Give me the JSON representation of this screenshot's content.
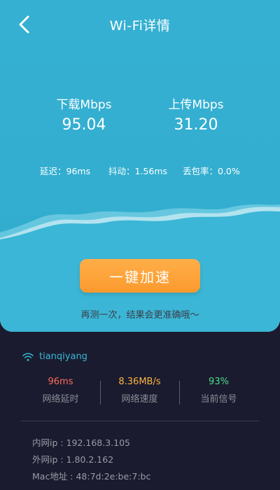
{
  "header": {
    "title": "Wi-Fi详情",
    "back_icon": "chevron-left-icon"
  },
  "speed": {
    "download_label": "下载Mbps",
    "download_value": "95.04",
    "upload_label": "上传Mbps",
    "upload_value": "31.20"
  },
  "stats": {
    "latency": "延迟：96ms",
    "jitter": "抖动：1.56ms",
    "packet_loss": "丢包率：0.0%"
  },
  "action": {
    "button_label": "一键加速",
    "hint": "再测一次，结果会更准确哦～"
  },
  "network": {
    "icon": "wifi-icon",
    "ssid": "tianqiyang"
  },
  "metrics": [
    {
      "value": "96ms",
      "label": "网络延时",
      "color": "#ff6b5e"
    },
    {
      "value": "8.36MB/s",
      "label": "网络速度",
      "color": "#ffb443"
    },
    {
      "value": "93%",
      "label": "当前信号",
      "color": "#4fdc8a"
    }
  ],
  "info": {
    "lan_ip": "内网ip : 192.168.3.105",
    "wan_ip": "外网ip : 1.80.2.162",
    "mac": "Mac地址 : 48:7d:2e:be:7:bc"
  },
  "colors": {
    "panel": "#35b0d2",
    "background": "#1a1b2e",
    "button": "#fb9a2e",
    "accent": "#38b8d8"
  }
}
